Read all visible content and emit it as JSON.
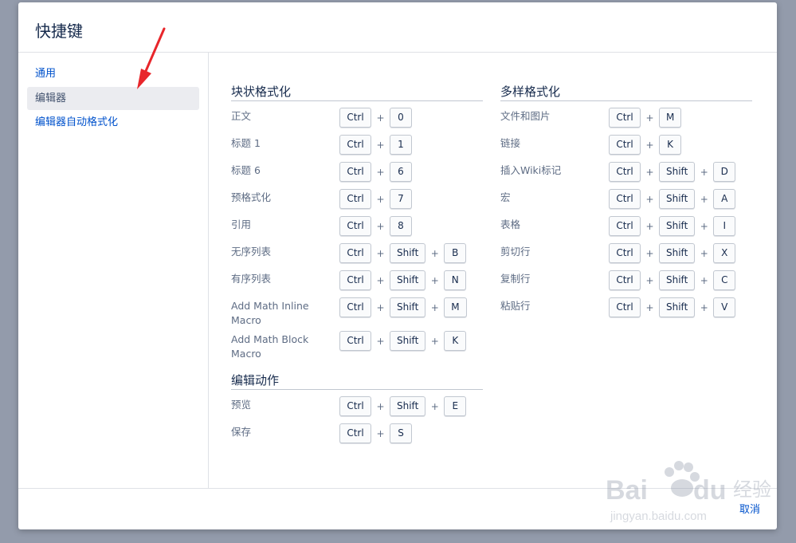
{
  "dialog": {
    "title": "快捷键",
    "cancel_label": "取消"
  },
  "sidebar": {
    "items": [
      {
        "label": "通用",
        "active": false
      },
      {
        "label": "编辑器",
        "active": true
      },
      {
        "label": "编辑器自动格式化",
        "active": false
      }
    ]
  },
  "sections": {
    "block": {
      "title": "块状格式化",
      "rows": [
        {
          "label": "正文",
          "keys": [
            "Ctrl",
            "0"
          ]
        },
        {
          "label": "标题 1",
          "keys": [
            "Ctrl",
            "1"
          ]
        },
        {
          "label": "标题 6",
          "keys": [
            "Ctrl",
            "6"
          ]
        },
        {
          "label": "预格式化",
          "keys": [
            "Ctrl",
            "7"
          ]
        },
        {
          "label": "引用",
          "keys": [
            "Ctrl",
            "8"
          ]
        },
        {
          "label": "无序列表",
          "keys": [
            "Ctrl",
            "Shift",
            "B"
          ]
        },
        {
          "label": "有序列表",
          "keys": [
            "Ctrl",
            "Shift",
            "N"
          ]
        },
        {
          "label": "Add Math Inline Macro",
          "keys": [
            "Ctrl",
            "Shift",
            "M"
          ]
        },
        {
          "label": "Add Math Block Macro",
          "keys": [
            "Ctrl",
            "Shift",
            "K"
          ]
        }
      ]
    },
    "edit": {
      "title": "编辑动作",
      "rows": [
        {
          "label": "预览",
          "keys": [
            "Ctrl",
            "Shift",
            "E"
          ]
        },
        {
          "label": "保存",
          "keys": [
            "Ctrl",
            "S"
          ]
        }
      ]
    },
    "rich": {
      "title": "多样格式化",
      "rows": [
        {
          "label": "文件和图片",
          "keys": [
            "Ctrl",
            "M"
          ]
        },
        {
          "label": "链接",
          "keys": [
            "Ctrl",
            "K"
          ]
        },
        {
          "label": "插入Wiki标记",
          "keys": [
            "Ctrl",
            "Shift",
            "D"
          ]
        },
        {
          "label": "宏",
          "keys": [
            "Ctrl",
            "Shift",
            "A"
          ]
        },
        {
          "label": "表格",
          "keys": [
            "Ctrl",
            "Shift",
            "I"
          ]
        },
        {
          "label": "剪切行",
          "keys": [
            "Ctrl",
            "Shift",
            "X"
          ]
        },
        {
          "label": "复制行",
          "keys": [
            "Ctrl",
            "Shift",
            "C"
          ]
        },
        {
          "label": "粘贴行",
          "keys": [
            "Ctrl",
            "Shift",
            "V"
          ]
        }
      ]
    }
  },
  "watermark": {
    "brand": "Bai du 经验",
    "url": "jingyan.baidu.com"
  },
  "colors": {
    "link": "#0052cc",
    "annotation_arrow": "#e8262b",
    "backdrop": "#939bab"
  }
}
